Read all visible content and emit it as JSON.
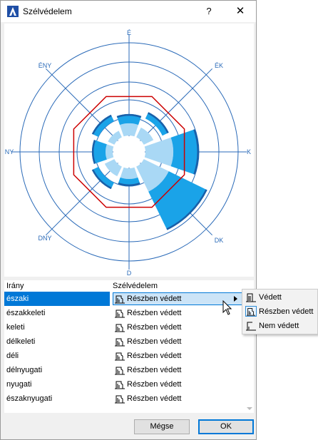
{
  "window": {
    "title": "Szélvédelem",
    "help_label": "?",
    "close_label": "✕"
  },
  "rose": {
    "directions": [
      "É",
      "ÉK",
      "K",
      "DK",
      "D",
      "DNY",
      "NY",
      "ÉNY"
    ],
    "colors": {
      "grid": "#2a6ab8",
      "inner_fill": "#a9d8f5",
      "outer_fill": "#1aa3e8",
      "outer_dark": "#1a5fa8",
      "outline": "#cc0000"
    }
  },
  "table": {
    "col_direction": "Irány",
    "col_protection": "Szélvédelem",
    "rows": [
      {
        "direction": "északi",
        "protection": "Részben védett"
      },
      {
        "direction": "északkeleti",
        "protection": "Részben védett"
      },
      {
        "direction": "keleti",
        "protection": "Részben védett"
      },
      {
        "direction": "délkeleti",
        "protection": "Részben védett"
      },
      {
        "direction": "déli",
        "protection": "Részben védett"
      },
      {
        "direction": "délnyugati",
        "protection": "Részben védett"
      },
      {
        "direction": "nyugati",
        "protection": "Részben védett"
      },
      {
        "direction": "északnyugati",
        "protection": "Részben védett"
      }
    ]
  },
  "menu": {
    "options": [
      "Védett",
      "Részben védett",
      "Nem védett"
    ],
    "selected": "Részben védett"
  },
  "buttons": {
    "cancel": "Mégse",
    "ok": "OK"
  }
}
